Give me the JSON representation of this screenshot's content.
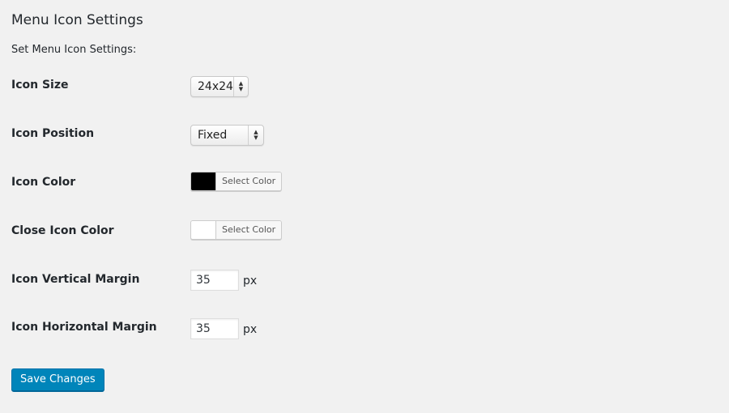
{
  "page": {
    "title": "Menu Icon Settings",
    "subtitle": "Set Menu Icon Settings:"
  },
  "fields": {
    "icon_size": {
      "label": "Icon Size",
      "value": "24x24"
    },
    "icon_position": {
      "label": "Icon Position",
      "value": "Fixed"
    },
    "icon_color": {
      "label": "Icon Color",
      "color": "#000000",
      "button_label": "Select Color"
    },
    "close_icon_color": {
      "label": "Close Icon Color",
      "color": "#ffffff",
      "button_label": "Select Color"
    },
    "icon_vertical_margin": {
      "label": "Icon Vertical Margin",
      "value": "35",
      "unit": "px"
    },
    "icon_horizontal_margin": {
      "label": "Icon Horizontal Margin",
      "value": "35",
      "unit": "px"
    }
  },
  "actions": {
    "save_label": "Save Changes"
  },
  "colors": {
    "primary_button": "#0085ba",
    "background": "#f1f1f1"
  }
}
